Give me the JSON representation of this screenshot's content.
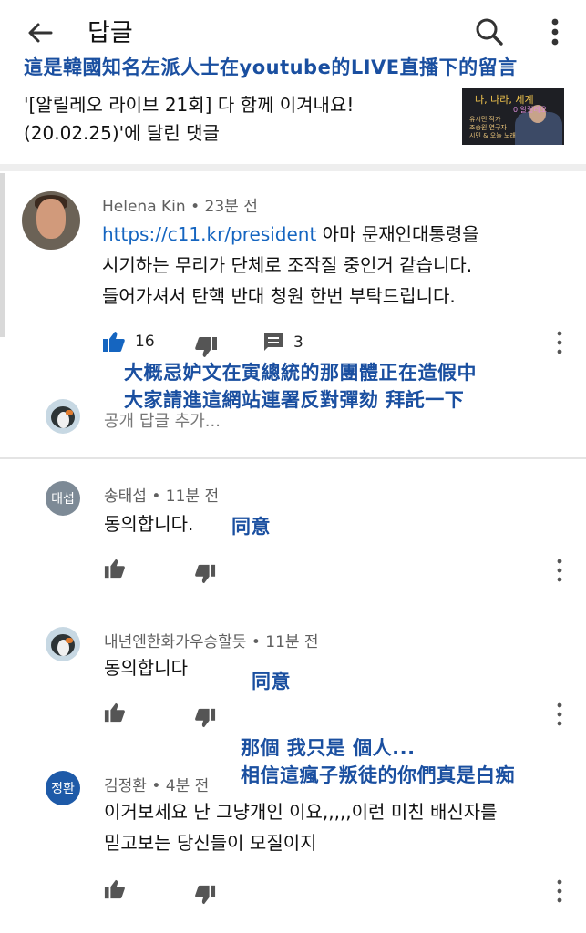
{
  "header": {
    "title": "답글"
  },
  "notes": {
    "top": "這是韓國知名左派人士在youtube的LIVE直播下的留言",
    "mid_line1": "大概忌妒文在寅總統的那團體正在造假中",
    "mid_line2": "大家請進這網站連署反對彈劾 拜託一下",
    "c1": "同意",
    "c2": "同意",
    "c3_line1": "那個 我只是 個人...",
    "c3_line2": "相信這瘋子叛徒的你們真是白痴"
  },
  "context": {
    "line1": "'[알릴레오 라이브 21회] 다 함께 이겨내요!",
    "line2": "(20.02.25)'에 달린 댓글",
    "thumb_title": "나, 나라, 세계",
    "thumb_sub": "0.알릴레오",
    "thumb_lines": [
      "유시민 작가",
      "조승원 연구자",
      "시민 & 오늘 노래"
    ]
  },
  "main_comment": {
    "author": "Helena Kin",
    "time": "23분 전",
    "link": "https://c11.kr/president",
    "text_after_link": " 아마 문재인대통령을",
    "line2": "시기하는 무리가 단체로 조작질 중인거 같습니다.",
    "line3": "들어가셔서 탄핵 반대 청원 한번 부탁드립니다.",
    "likes": "16",
    "replies": "3"
  },
  "reply_box": {
    "placeholder": "공개 답글 추가..."
  },
  "replies": [
    {
      "avatar_text": "태섭",
      "author": "송태섭",
      "time": "11분 전",
      "text": "동의합니다."
    },
    {
      "author": "내년엔한화가우승할듯",
      "time": "11분 전",
      "text": "동의합니다"
    },
    {
      "avatar_text": "정환",
      "author": "김정환",
      "time": "4분 전",
      "line1": "이거보세요  난 그냥개인 이요,,,,,이런 미친 배신자를",
      "line2": "믿고보는 당신들이 모질이지"
    }
  ],
  "colors": {
    "annotation_blue": "#1a4fa0",
    "link_blue": "#1565c0",
    "like_active": "#1565c0",
    "avatar1": "#7d8a96",
    "avatar3": "#1e5aa8"
  },
  "icons": [
    "back-arrow-icon",
    "search-icon",
    "more-vert-icon",
    "thumb-up-icon",
    "thumb-down-icon",
    "comment-icon"
  ]
}
